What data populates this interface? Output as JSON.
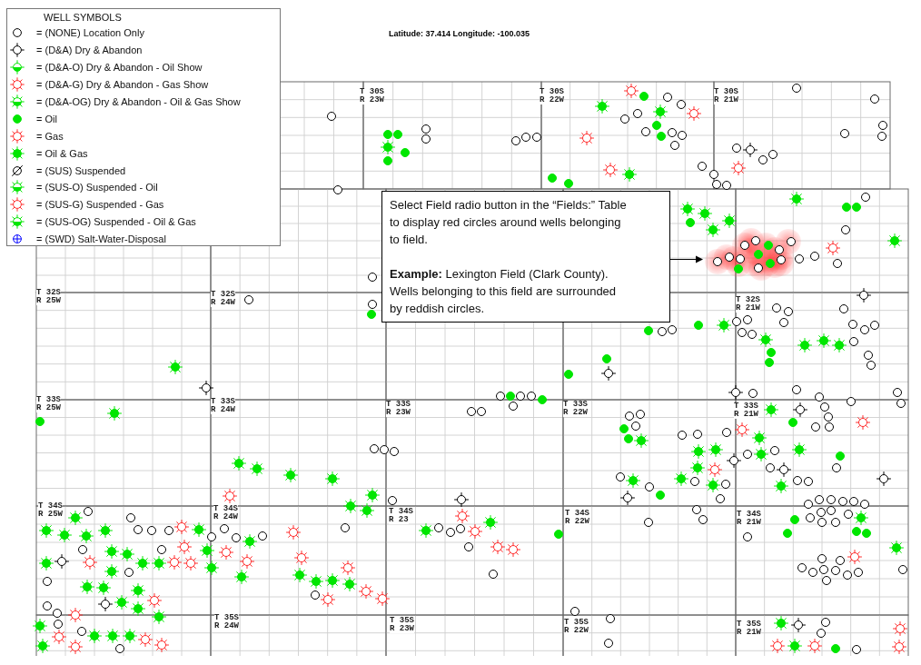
{
  "legend": {
    "title": "WELL SYMBOLS",
    "items": [
      {
        "kind": "none",
        "label": "= (NONE) Location Only"
      },
      {
        "kind": "da",
        "label": "= (D&A) Dry & Abandon"
      },
      {
        "kind": "da-o",
        "label": "= (D&A-O) Dry & Abandon - Oil Show"
      },
      {
        "kind": "da-g",
        "label": "= (D&A-G) Dry & Abandon - Gas Show"
      },
      {
        "kind": "da-og",
        "label": "= (D&A-OG) Dry & Abandon - Oil & Gas Show"
      },
      {
        "kind": "oil",
        "label": "= Oil"
      },
      {
        "kind": "gas",
        "label": "= Gas"
      },
      {
        "kind": "oil-gas",
        "label": "= Oil & Gas"
      },
      {
        "kind": "sus",
        "label": "= (SUS) Suspended"
      },
      {
        "kind": "sus-o",
        "label": "= (SUS-O) Suspended - Oil"
      },
      {
        "kind": "sus-g",
        "label": "= (SUS-G) Suspended - Gas"
      },
      {
        "kind": "sus-og",
        "label": "= (SUS-OG) Suspended - Oil & Gas"
      },
      {
        "kind": "swd",
        "label": "= (SWD) Salt-Water-Disposal"
      }
    ]
  },
  "coordinates": "Latitude: 37.414 Longitude: -100.035",
  "callout": {
    "paragraphs": [
      "Select Field radio button in the “Fields:” Table to display red circles around wells belonging to field.",
      "**Example:** Lexington Field (Clark County). Wells belonging to this field are surrounded by reddish circles."
    ]
  },
  "map": {
    "township_labels": [
      {
        "township": "T 30S",
        "range": "R 23W"
      },
      {
        "township": "T 30S",
        "range": "R 22W"
      },
      {
        "township": "T 30S",
        "range": "R 21W"
      },
      {
        "township": "T 32S",
        "range": "R 25W"
      },
      {
        "township": "T 32S",
        "range": "R 24W"
      },
      {
        "township": "T 32S",
        "range": "R 21W"
      },
      {
        "township": "T 33S",
        "range": "R 25W"
      },
      {
        "township": "T 33S",
        "range": "R 24W"
      },
      {
        "township": "T 33S",
        "range": "R 23W"
      },
      {
        "township": "T 33S",
        "range": "R 22W"
      },
      {
        "township": "T 33S",
        "range": "R 21W"
      },
      {
        "township": "T 34S",
        "range": "R 25W"
      },
      {
        "township": "T 34S",
        "range": "R 24W"
      },
      {
        "township": "T 34S",
        "range": "R 23"
      },
      {
        "township": "T 34S",
        "range": "R 22W"
      },
      {
        "township": "T 34S",
        "range": "R 21W"
      },
      {
        "township": "T 35S",
        "range": "R 24W"
      },
      {
        "township": "T 35S",
        "range": "R 23W"
      },
      {
        "township": "T 35S",
        "range": "R 22W"
      },
      {
        "township": "T 35S",
        "range": "R 21W"
      }
    ]
  }
}
